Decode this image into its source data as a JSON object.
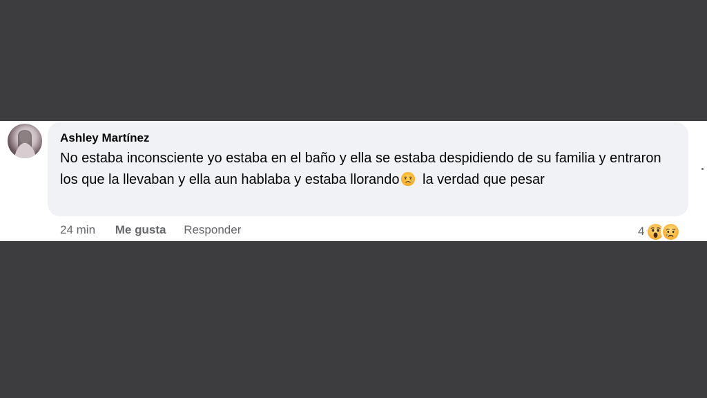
{
  "comment": {
    "author": "Ashley Martínez",
    "avatar_icon": "profile-photo",
    "text_before": "No estaba inconsciente yo estaba en el baño y ella se estaba despidiendo de su familia y entraron los que la llevaban y ella aun hablaba y estaba llorando",
    "inline_emoji": "crying-face",
    "text_after": "la verdad que pesar"
  },
  "actions": {
    "time": "24 min",
    "like_label": "Me gusta",
    "reply_label": "Responder"
  },
  "reactions": {
    "count": "4",
    "icons": [
      "wow-reaction",
      "sad-reaction"
    ]
  },
  "colors": {
    "backdrop": "#3d3d3f",
    "bubble": "#f0f2f5",
    "text": "#050505",
    "secondary_text": "#65676b"
  }
}
